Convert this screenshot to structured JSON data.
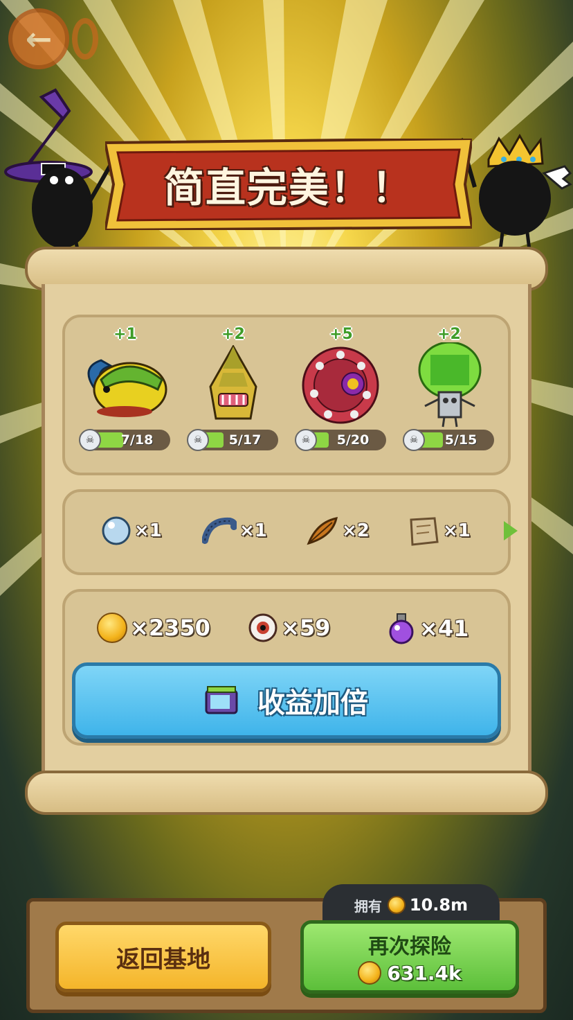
{
  "header": {
    "back_icon": "left-arrow-icon",
    "title": "简直完美！！"
  },
  "monsters": [
    {
      "name_icon": "beetle-monster-icon",
      "gain": "+1",
      "progress_text": "7/18",
      "progress": 0.39
    },
    {
      "name_icon": "bamboo-monster-icon",
      "gain": "+2",
      "progress_text": "5/17",
      "progress": 0.29
    },
    {
      "name_icon": "eye-flower-monster-icon",
      "gain": "+5",
      "progress_text": "5/20",
      "progress": 0.25
    },
    {
      "name_icon": "robot-monster-icon",
      "gain": "+2",
      "progress_text": "5/15",
      "progress": 0.33
    }
  ],
  "materials": [
    {
      "icon": "pearl-icon",
      "qty": "×1"
    },
    {
      "icon": "worm-icon",
      "qty": "×1"
    },
    {
      "icon": "feather-icon",
      "qty": "×2"
    },
    {
      "icon": "scroll-map-icon",
      "qty": "×1"
    }
  ],
  "resources": [
    {
      "icon": "coin-icon",
      "qty": "×2350"
    },
    {
      "icon": "eyeball-icon",
      "qty": "×59"
    },
    {
      "icon": "potion-icon",
      "qty": "×41"
    }
  ],
  "double_button": {
    "label": "收益加倍",
    "icon": "tv-ad-icon"
  },
  "footer": {
    "owned_label": "拥有",
    "owned_value": "10.8m",
    "home_label": "返回基地",
    "again_label": "再次探险",
    "again_cost": "631.4k"
  },
  "colors": {
    "accent_green": "#5cbf3a",
    "accent_blue": "#3fb4ea",
    "accent_yellow": "#f4b52a",
    "banner_red": "#b8321e"
  }
}
